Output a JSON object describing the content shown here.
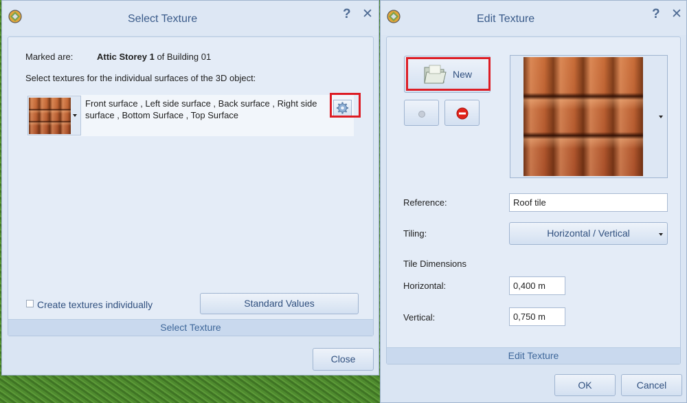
{
  "select_dialog": {
    "title": "Select Texture",
    "help_icon": "?",
    "close_icon": "✕",
    "marked_label": "Marked are:",
    "marked_storey": "Attic Storey 1",
    "marked_rest": "of Building 01",
    "instruction": "Select textures for the individual surfaces of the 3D object:",
    "surfaces_text": "Front surface , Left side surface , Back surface , Right side surface , Bottom Surface , Top Surface",
    "create_individually_label": "Create textures individually",
    "create_individually_checked": false,
    "standard_values_button": "Standard Values",
    "panel_footer": "Select Texture",
    "close_button": "Close"
  },
  "edit_dialog": {
    "title": "Edit Texture",
    "help_icon": "?",
    "close_icon": "✕",
    "new_button": "New",
    "reference_label": "Reference:",
    "reference_value": "Roof tile",
    "tiling_label": "Tiling:",
    "tiling_value": "Horizontal / Vertical",
    "tile_dimensions_label": "Tile Dimensions",
    "horizontal_label": "Horizontal:",
    "horizontal_value": "0,400 m",
    "vertical_label": "Vertical:",
    "vertical_value": "0,750 m",
    "panel_footer": "Edit Texture",
    "ok_button": "OK",
    "cancel_button": "Cancel"
  },
  "colors": {
    "highlight": "#dd1c24",
    "accent_text": "#3a5b8a",
    "dialog_bg": "#dae5f3"
  },
  "icons": {
    "app": "app-globe-icon",
    "settings": "gear-icon",
    "folder": "folder-icon",
    "remove": "remove-icon",
    "dropdown": "dropdown-arrow-icon"
  }
}
